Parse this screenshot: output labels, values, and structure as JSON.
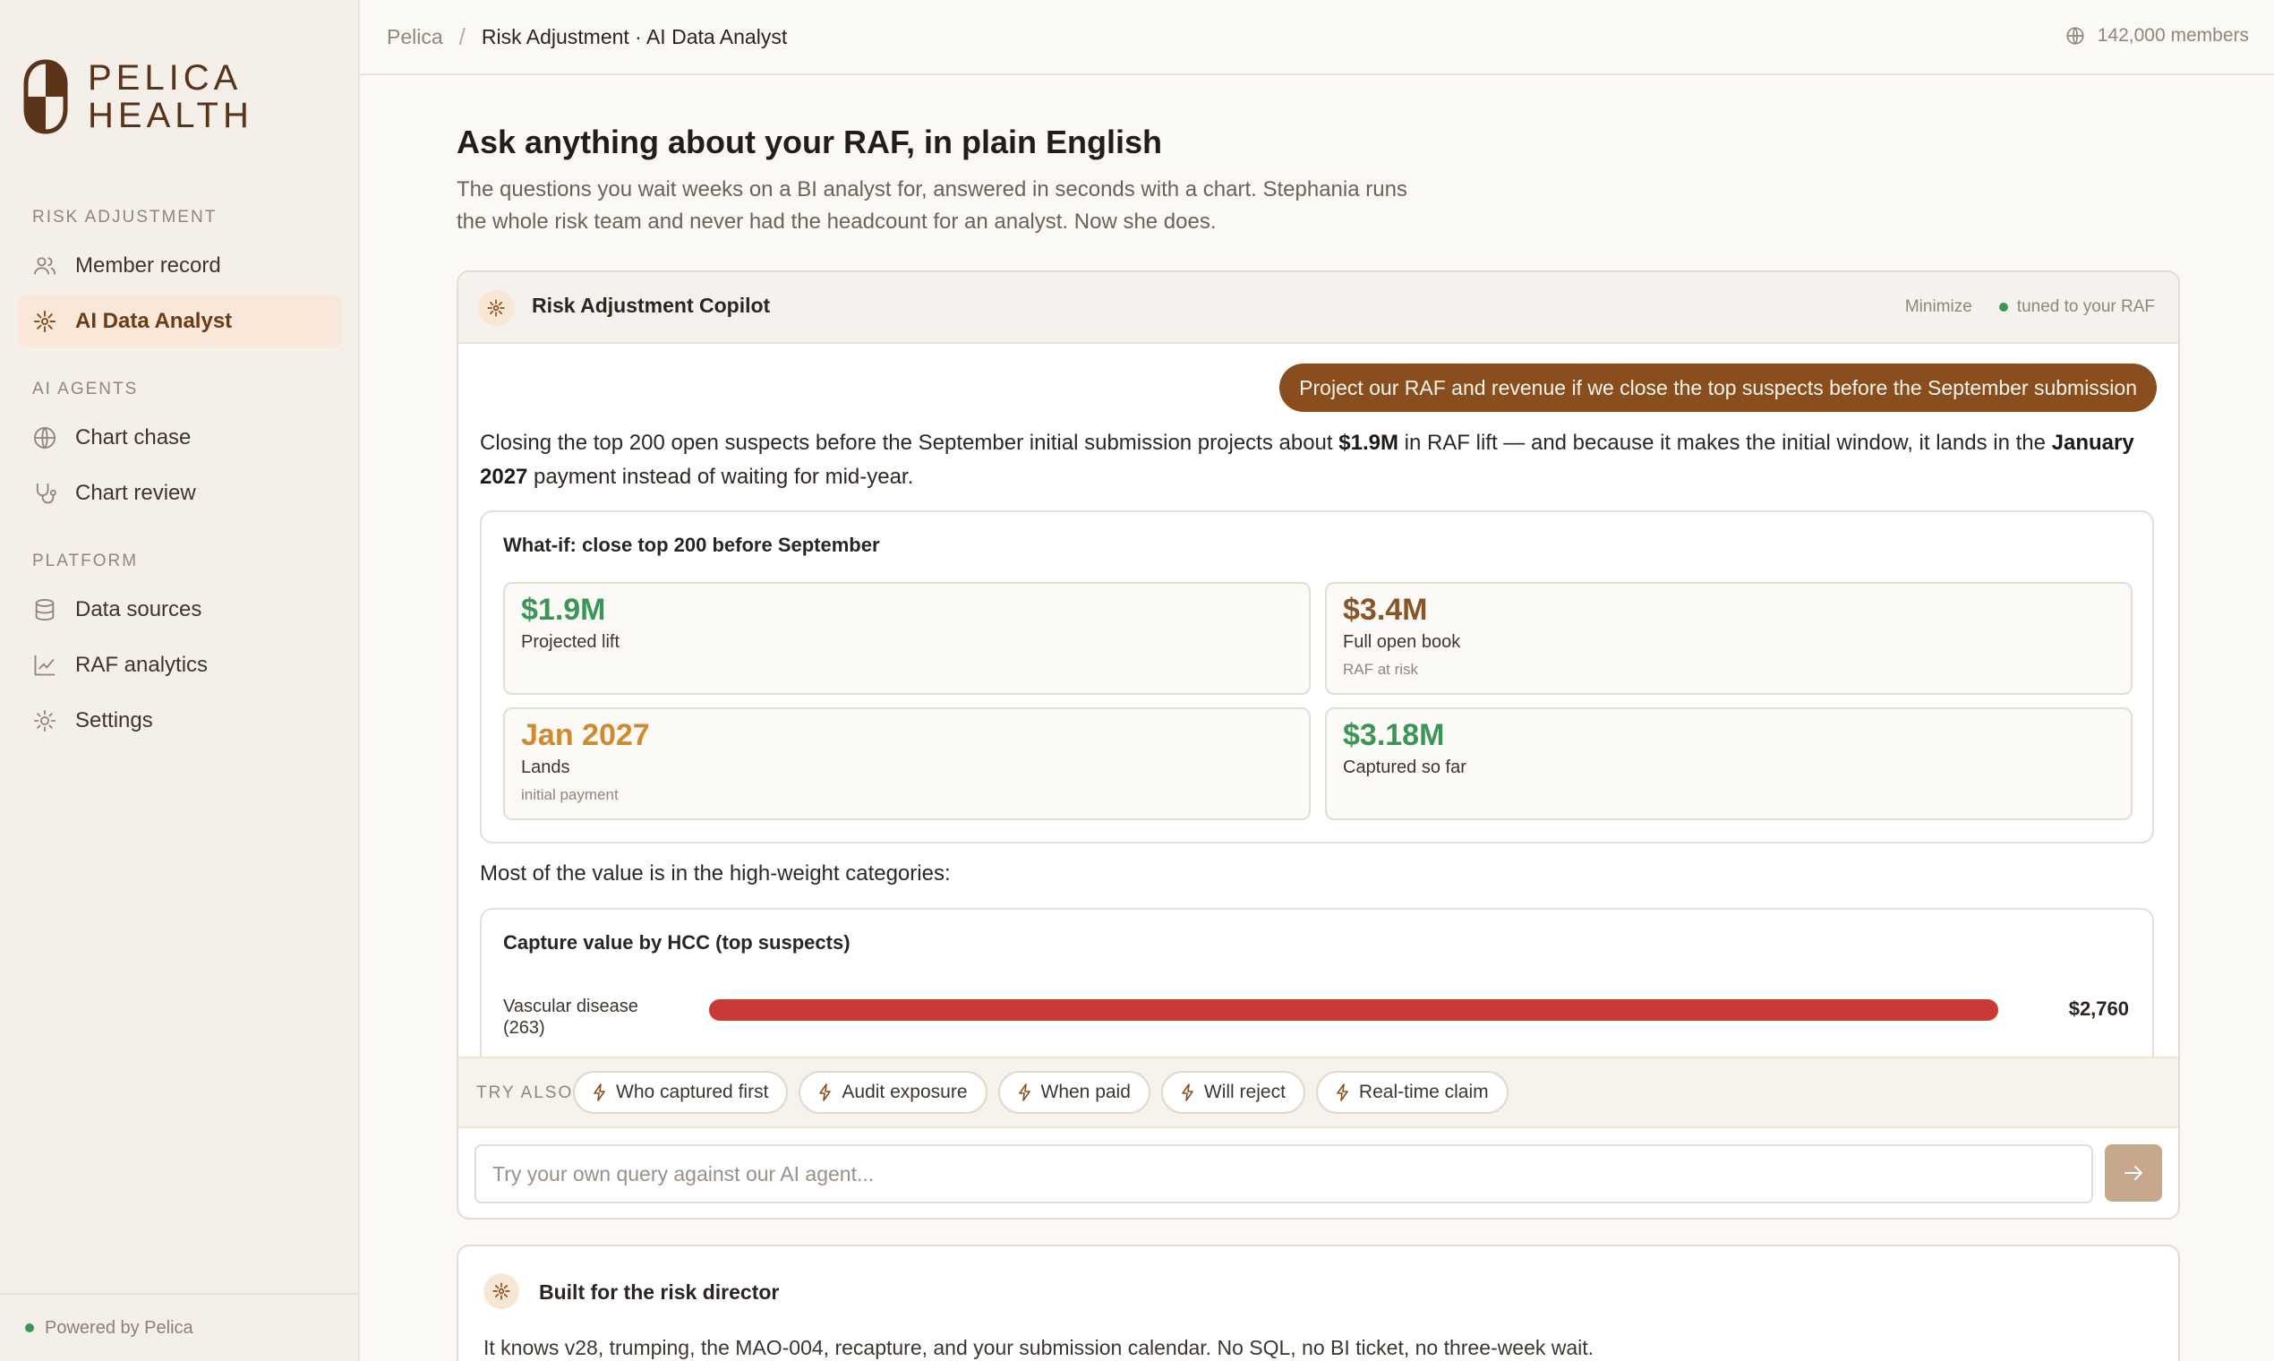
{
  "brand": {
    "name_line1": "PELICA",
    "name_line2": "HEALTH",
    "accent": "#5a3318"
  },
  "sidebar": {
    "sections": [
      {
        "label": "RISK ADJUSTMENT"
      },
      {
        "label": "AI AGENTS"
      },
      {
        "label": "PLATFORM"
      }
    ],
    "items": [
      {
        "label": "Member record",
        "icon": "users-icon"
      },
      {
        "label": "AI Data Analyst",
        "icon": "sparkle-icon",
        "active": true
      },
      {
        "label": "Chart chase",
        "icon": "globe-icon"
      },
      {
        "label": "Chart review",
        "icon": "stethoscope-icon"
      },
      {
        "label": "Data sources",
        "icon": "database-icon"
      },
      {
        "label": "RAF analytics",
        "icon": "line-chart-icon"
      },
      {
        "label": "Settings",
        "icon": "gear-icon"
      }
    ],
    "powered": "Powered by Pelica"
  },
  "topbar": {
    "crumb_root": "Pelica",
    "crumb_sep": "/",
    "crumb_current": "Risk Adjustment · AI Data Analyst",
    "members": "142,000 members"
  },
  "main": {
    "title": "Ask anything about your RAF, in plain English",
    "subtitle": "The questions you wait weeks on a BI analyst for, answered in seconds with a chart. Stephania runs the whole risk team and never had the headcount for an analyst. Now she does."
  },
  "copilot": {
    "title": "Risk Adjustment Copilot",
    "minimize": "Minimize",
    "tuned": "tuned to your RAF",
    "user_message": "Project our RAF and revenue if we close the top suspects before the September submission",
    "answer": {
      "p1": "Closing the top 200 open suspects before the September initial submission projects about ",
      "b1": "$1.9M",
      "p2": " in RAF lift — and because it makes the initial window, it lands in the ",
      "b2": "January 2027",
      "p3": " payment instead of waiting for mid-year."
    },
    "whatif": {
      "title": "What-if: close top 200 before September",
      "kpis": [
        {
          "value": "$1.9M",
          "label": "Projected lift",
          "sub": "",
          "color": "#3b9656"
        },
        {
          "value": "$3.4M",
          "label": "Full open book",
          "sub": "RAF at risk",
          "color": "#8a5526"
        },
        {
          "value": "Jan 2027",
          "label": "Lands",
          "sub": "initial payment",
          "color": "#d08a2e"
        },
        {
          "value": "$3.18M",
          "label": "Captured so far",
          "sub": "",
          "color": "#3b9656"
        }
      ]
    },
    "lead": "Most of the value is in the high-weight categories:",
    "hcc": {
      "title": "Capture value by HCC (top suspects)",
      "bars": [
        {
          "label_line1": "Vascular disease",
          "label_line2": "(263)",
          "value_text": "$2,760",
          "fill": 1.0,
          "color": "#c93a36"
        }
      ]
    },
    "try_also": {
      "label": "TRY ALSO",
      "chips": [
        "Who captured first",
        "Audit exposure",
        "When paid",
        "Will reject",
        "Real-time claim"
      ]
    },
    "input_placeholder": "Try your own query against our AI agent..."
  },
  "built": {
    "title": "Built for the risk director",
    "body": "It knows v28, trumping, the MAO-004, recapture, and your submission calendar. No SQL, no BI ticket, no three-week wait."
  }
}
